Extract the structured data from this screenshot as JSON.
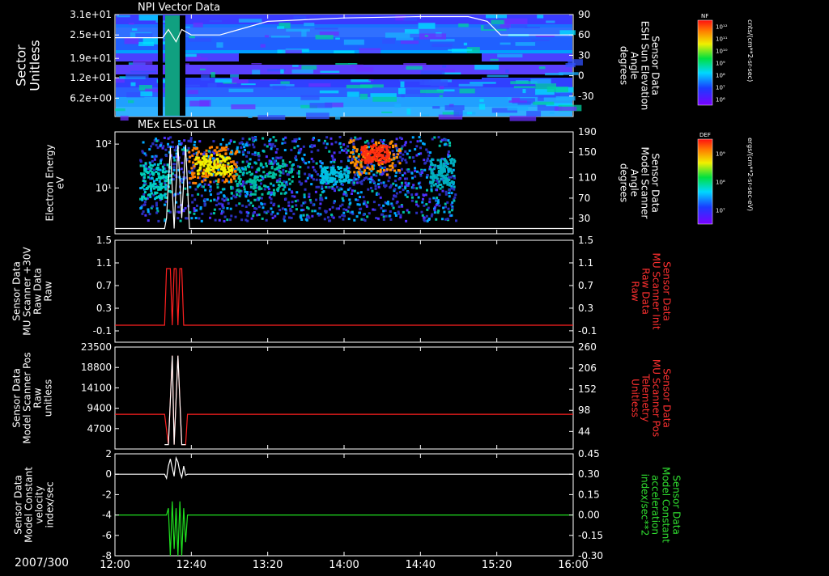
{
  "date_label": "2007/300",
  "x_ticks": [
    "12:00",
    "12:40",
    "13:20",
    "14:00",
    "14:40",
    "15:20",
    "16:00"
  ],
  "colors": {
    "background": "#000000",
    "axes": "#ffffff",
    "red_trace": "#ff2020",
    "green_trace": "#20e020",
    "white_trace": "#ffffff"
  },
  "chart_data": [
    {
      "type": "heatmap",
      "title": "NPI Vector Data",
      "ylabel": [
        "Sector",
        "Unitless"
      ],
      "y_ticks": [
        "3.1e+01",
        "2.5e+01",
        "1.9e+01",
        "1.2e+01",
        "6.2e+00"
      ],
      "y2label": [
        "Sensor Data",
        "ESH Sun Elevation",
        "Angle",
        "degrees"
      ],
      "y2_ticks": [
        "90",
        "60",
        "30",
        "0",
        "-30"
      ],
      "colorbar": {
        "title": "NF",
        "ticks": [
          "10¹²",
          "10¹¹",
          "10¹⁰",
          "10⁹",
          "10⁸",
          "10⁷",
          "10⁶"
        ],
        "units": "cnts/(cm**2-sr-sec)"
      },
      "overlay_series": [
        {
          "axis": "y2",
          "color": "white",
          "x": [
            "12:00",
            "12:25",
            "12:28",
            "12:32",
            "12:35",
            "12:40",
            "12:55",
            "13:05",
            "13:20",
            "14:00",
            "14:40",
            "15:05",
            "15:15",
            "15:22",
            "16:00"
          ],
          "y": [
            56,
            56,
            68,
            50,
            68,
            60,
            60,
            68,
            80,
            85,
            87,
            87,
            80,
            60,
            60
          ]
        }
      ]
    },
    {
      "type": "heatmap",
      "title": "MEx ELS-01 LR",
      "ylabel": [
        "Electron Energy",
        "eV"
      ],
      "y_ticks": [
        "10²",
        "10¹"
      ],
      "y2label": [
        "Sensor Data",
        "Model Scanner",
        "Angle",
        "degrees"
      ],
      "y2_ticks": [
        "190",
        "150",
        "110",
        "70",
        "30"
      ],
      "colorbar": {
        "title": "DEF",
        "ticks": [
          "10⁹",
          "10⁸",
          "10⁷"
        ],
        "units": "ergs/(cm**2-sr-sec-eV)"
      },
      "overlay_series": [
        {
          "axis": "y2",
          "color": "white",
          "x": [
            "12:00",
            "12:26",
            "12:27",
            "12:29",
            "12:31",
            "12:33",
            "12:35",
            "12:37",
            "12:39",
            "16:00"
          ],
          "y": [
            5,
            5,
            25,
            160,
            5,
            165,
            25,
            165,
            5,
            5
          ]
        }
      ]
    },
    {
      "type": "line",
      "ylabel": [
        "Sensor Data",
        "MU Scanner +30V",
        "Raw Data",
        "Raw"
      ],
      "y_ticks": [
        "1.5",
        "1.1",
        "0.7",
        "0.3",
        "-0.1"
      ],
      "ylim": [
        -0.3,
        1.5
      ],
      "y2label": [
        "Sensor Data",
        "MU Scanner Init",
        "Raw Data",
        "Raw"
      ],
      "y2_ticks": [
        "1.5",
        "1.1",
        "0.7",
        "0.3",
        "-0.1"
      ],
      "series": [
        {
          "color": "red",
          "x": [
            "12:00",
            "12:26",
            "12:27",
            "12:29",
            "12:30",
            "12:31",
            "12:32",
            "12:33",
            "12:34",
            "12:35",
            "12:36",
            "12:37",
            "12:38",
            "16:00"
          ],
          "y": [
            0,
            0,
            1,
            1,
            0,
            1,
            1,
            0,
            1,
            1,
            0,
            0,
            0,
            0
          ]
        }
      ]
    },
    {
      "type": "line",
      "ylabel": [
        "Sensor Data",
        "Model Scanner Pos",
        "Raw",
        "unitless"
      ],
      "y_ticks": [
        "23500",
        "18800",
        "14100",
        "9400",
        "4700"
      ],
      "ylim": [
        0,
        23500
      ],
      "y2label": [
        "Sensor Data",
        "MU Scanner Pos",
        "Telemetry",
        "Unitless"
      ],
      "y2_ticks": [
        "260",
        "206",
        "152",
        "98",
        "44"
      ],
      "series": [
        {
          "color": "red",
          "x": [
            "12:00",
            "12:26",
            "12:28",
            "12:30",
            "12:31",
            "12:33",
            "12:35",
            "12:37",
            "12:38",
            "16:00"
          ],
          "y": [
            8000,
            8000,
            1000,
            21500,
            1000,
            21500,
            1000,
            1000,
            8000,
            8000
          ]
        },
        {
          "color": "white",
          "x": [
            "12:26",
            "12:28",
            "12:30",
            "12:31",
            "12:33",
            "12:35",
            "12:37"
          ],
          "y": [
            1000,
            1000,
            21500,
            1000,
            21500,
            1000,
            1000
          ]
        }
      ]
    },
    {
      "type": "line",
      "ylabel": [
        "Sensor Data",
        "Model Constant",
        "velocity",
        "index/sec"
      ],
      "y_ticks": [
        "2",
        "0",
        "-2",
        "-4",
        "-6",
        "-8"
      ],
      "ylim": [
        -8,
        2
      ],
      "y2label": [
        "Sensor Data",
        "Model Constant",
        "acceleration",
        "index/sec**2"
      ],
      "y2_ticks": [
        "0.45",
        "0.30",
        "0.15",
        "0.00",
        "-0.15",
        "-0.30"
      ],
      "series": [
        {
          "color": "white",
          "x": [
            "12:00",
            "12:26",
            "12:27",
            "12:28",
            "12:29",
            "12:30",
            "12:31",
            "12:32",
            "12:33",
            "12:34",
            "12:35",
            "12:36",
            "12:37",
            "12:38",
            "16:00"
          ],
          "y": [
            0,
            0,
            -0.4,
            0.8,
            1.5,
            0.6,
            -0.2,
            1.6,
            1.2,
            0.2,
            -0.3,
            0.8,
            -0.1,
            0,
            0
          ]
        },
        {
          "color": "green",
          "axis": "y2",
          "x": [
            "12:00",
            "12:27",
            "12:28",
            "12:29",
            "12:30",
            "12:31",
            "12:32",
            "12:33",
            "12:34",
            "12:35",
            "12:36",
            "12:37",
            "12:38",
            "16:00"
          ],
          "y": [
            0,
            0,
            0.05,
            -0.3,
            0.1,
            -0.25,
            0.05,
            -0.3,
            0.1,
            -0.3,
            0.05,
            -0.2,
            0,
            0
          ]
        }
      ]
    }
  ]
}
